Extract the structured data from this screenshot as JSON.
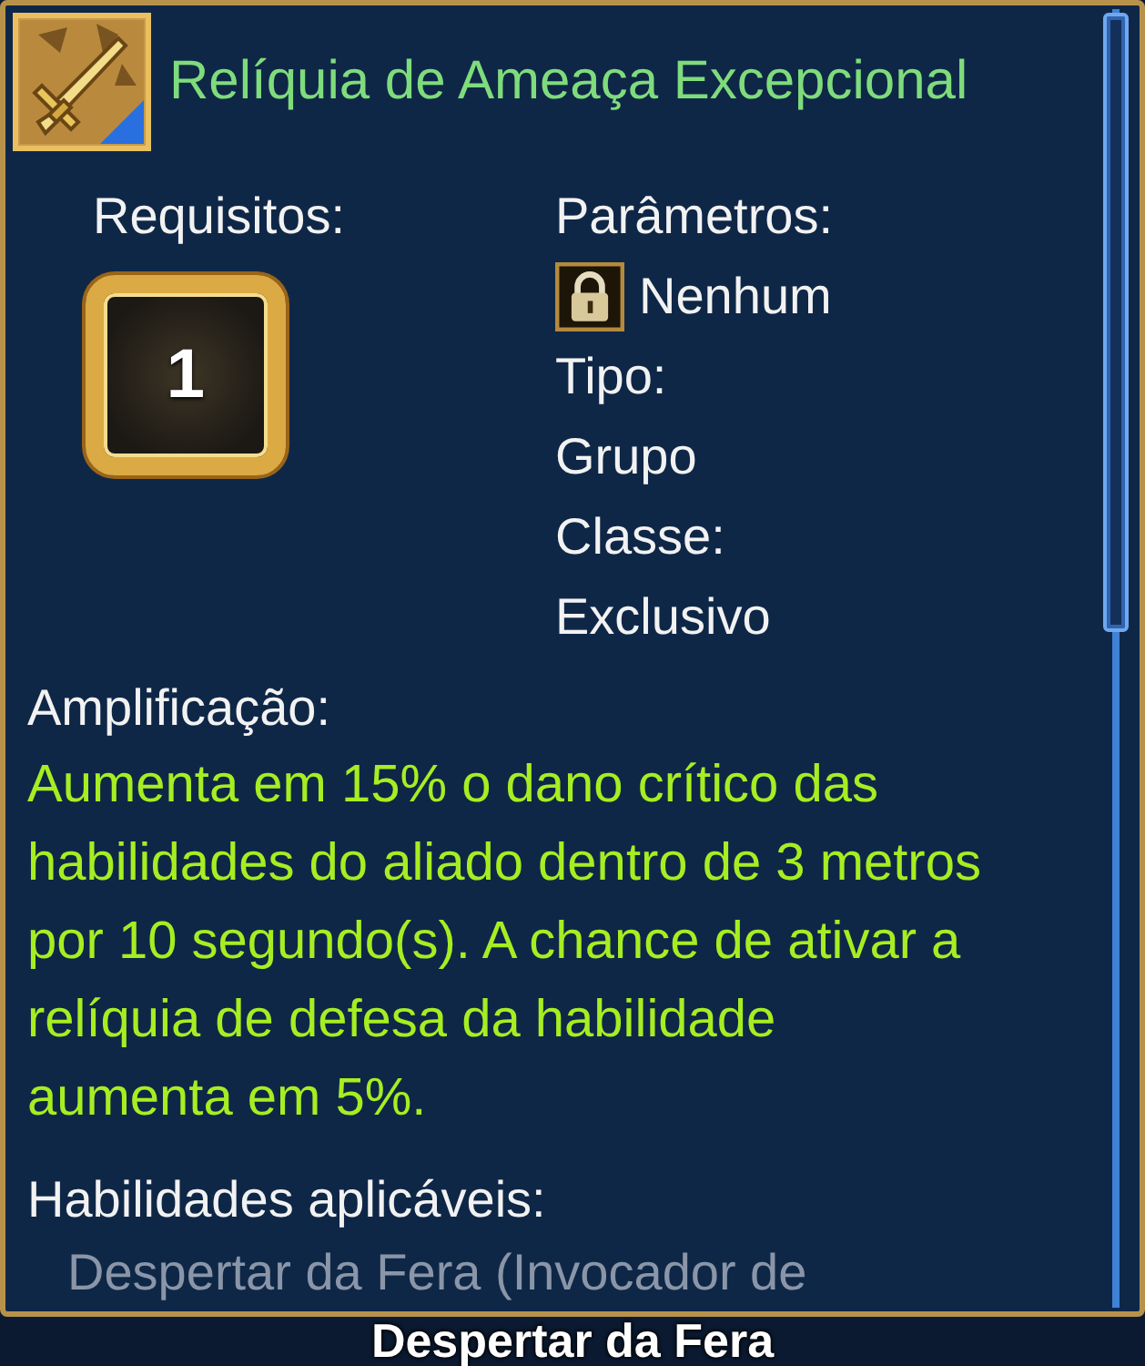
{
  "item": {
    "title": "Relíquia de Ameaça Excepcional"
  },
  "requirements": {
    "label": "Requisitos:",
    "required_level": "1"
  },
  "parameters": {
    "label": "Parâmetros:",
    "value": "Nenhum"
  },
  "type": {
    "label": "Tipo:",
    "value": "Grupo"
  },
  "class": {
    "label": "Classe:",
    "value": "Exclusivo"
  },
  "amplification": {
    "label": "Amplificação:",
    "description_lines": [
      "Aumenta em 15% o dano crítico das",
      "habilidades do aliado dentro de 3 metros",
      "por 10 segundo(s). A chance de ativar a",
      "relíquia de defesa da habilidade",
      "aumenta em 5%."
    ]
  },
  "applicable_skills": {
    "label": "Habilidades aplicáveis:",
    "items": [
      "Despertar da Fera (Invocador de"
    ]
  },
  "background_text": "Despertar da Fera"
}
